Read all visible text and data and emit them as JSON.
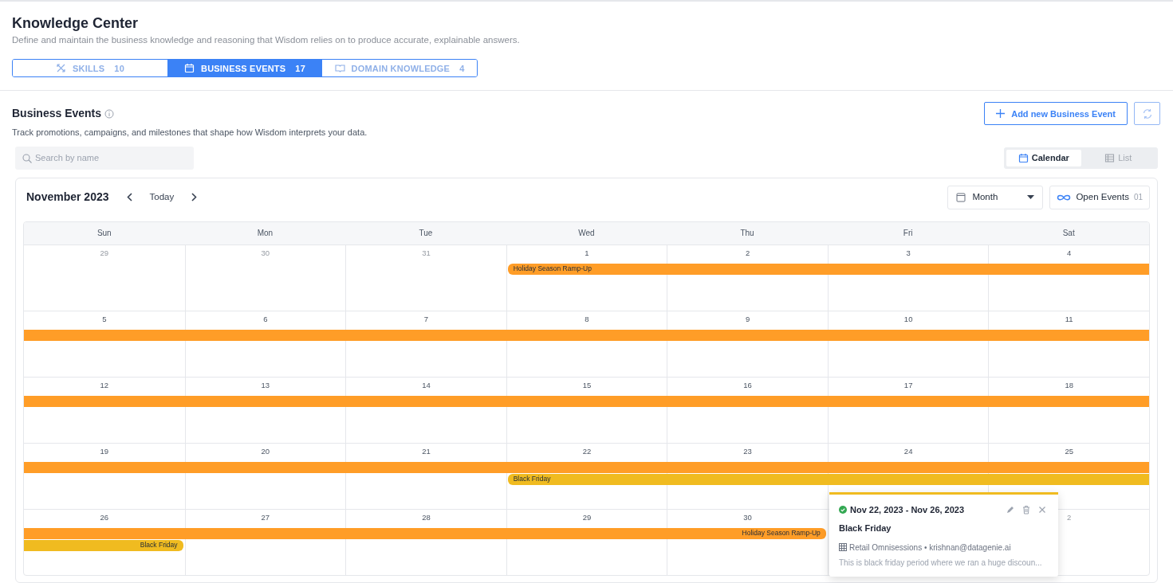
{
  "header": {
    "title": "Knowledge Center",
    "subtitle": "Define and maintain the business knowledge and reasoning that Wisdom relies on to produce accurate, explainable answers."
  },
  "tabs": [
    {
      "label": "SKILLS",
      "count": "10",
      "selected": false
    },
    {
      "label": "BUSINESS EVENTS",
      "count": "17",
      "selected": true
    },
    {
      "label": "DOMAIN KNOWLEDGE",
      "count": "4",
      "selected": false
    }
  ],
  "section": {
    "title": "Business Events",
    "description": "Track promotions, campaigns, and milestones that shape how Wisdom interprets your data.",
    "add_button": "Add new Business Event"
  },
  "search": {
    "placeholder": "Search by name"
  },
  "view_toggle": [
    {
      "label": "Calendar",
      "selected": true
    },
    {
      "label": "List",
      "selected": false
    }
  ],
  "calendar": {
    "month": "November 2023",
    "today_button": "Today",
    "view_select": "Month",
    "open_events": {
      "label": "Open Events",
      "count": "01"
    },
    "weekdays": [
      "Sun",
      "Mon",
      "Tue",
      "Wed",
      "Thu",
      "Fri",
      "Sat"
    ],
    "weeks": [
      {
        "days": [
          {
            "kind": "date",
            "number": "29",
            "outside_month": true
          },
          {
            "kind": "date",
            "number": "30",
            "outside_month": true
          },
          {
            "kind": "date",
            "number": "31",
            "outside_month": true
          },
          {
            "kind": "date",
            "number": "1",
            "outside_month": false
          },
          {
            "kind": "date",
            "number": "2",
            "outside_month": false
          },
          {
            "kind": "date",
            "number": "3",
            "outside_month": false
          },
          {
            "kind": "date",
            "number": "4",
            "outside_month": false
          }
        ],
        "lanes": [
          {
            "label": "Holiday Season Ramp-Up",
            "color": "#ff9d27",
            "segments": [
              {
                "kind": "none"
              },
              {
                "kind": "none"
              },
              {
                "kind": "none"
              },
              {
                "kind": "start"
              },
              {
                "kind": "middle"
              },
              {
                "kind": "middle"
              },
              {
                "kind": "middle"
              }
            ]
          }
        ]
      },
      {
        "days": [
          {
            "kind": "date",
            "number": "5",
            "outside_month": false
          },
          {
            "kind": "date",
            "number": "6",
            "outside_month": false
          },
          {
            "kind": "date",
            "number": "7",
            "outside_month": false
          },
          {
            "kind": "date",
            "number": "8",
            "outside_month": false
          },
          {
            "kind": "date",
            "number": "9",
            "outside_month": false
          },
          {
            "kind": "date",
            "number": "10",
            "outside_month": false
          },
          {
            "kind": "date",
            "number": "11",
            "outside_month": false
          }
        ],
        "lanes": [
          {
            "color": "#ff9d27",
            "segments": [
              {
                "kind": "middle"
              },
              {
                "kind": "middle"
              },
              {
                "kind": "middle"
              },
              {
                "kind": "middle"
              },
              {
                "kind": "middle"
              },
              {
                "kind": "middle"
              },
              {
                "kind": "middle"
              }
            ]
          }
        ]
      },
      {
        "days": [
          {
            "kind": "date",
            "number": "12",
            "outside_month": false
          },
          {
            "kind": "date",
            "number": "13",
            "outside_month": false
          },
          {
            "kind": "date",
            "number": "14",
            "outside_month": false
          },
          {
            "kind": "date",
            "number": "15",
            "outside_month": false
          },
          {
            "kind": "date",
            "number": "16",
            "outside_month": false
          },
          {
            "kind": "date",
            "number": "17",
            "outside_month": false
          },
          {
            "kind": "date",
            "number": "18",
            "outside_month": false
          }
        ],
        "lanes": [
          {
            "color": "#ff9d27",
            "segments": [
              {
                "kind": "middle"
              },
              {
                "kind": "middle"
              },
              {
                "kind": "middle"
              },
              {
                "kind": "middle"
              },
              {
                "kind": "middle"
              },
              {
                "kind": "middle"
              },
              {
                "kind": "middle"
              }
            ]
          }
        ]
      },
      {
        "days": [
          {
            "kind": "date",
            "number": "19",
            "outside_month": false
          },
          {
            "kind": "date",
            "number": "20",
            "outside_month": false
          },
          {
            "kind": "date",
            "number": "21",
            "outside_month": false
          },
          {
            "kind": "date",
            "number": "22",
            "outside_month": false
          },
          {
            "kind": "date",
            "number": "23",
            "outside_month": false
          },
          {
            "kind": "date",
            "number": "24",
            "outside_month": false
          },
          {
            "kind": "date",
            "number": "25",
            "outside_month": false
          }
        ],
        "lanes": [
          {
            "color": "#ff9d27",
            "segments": [
              {
                "kind": "middle"
              },
              {
                "kind": "middle"
              },
              {
                "kind": "middle"
              },
              {
                "kind": "middle"
              },
              {
                "kind": "middle"
              },
              {
                "kind": "middle"
              },
              {
                "kind": "middle"
              }
            ]
          },
          {
            "label": "Black Friday",
            "color": "#f0bb20",
            "segments": [
              {
                "kind": "none"
              },
              {
                "kind": "none"
              },
              {
                "kind": "none"
              },
              {
                "kind": "start"
              },
              {
                "kind": "middle"
              },
              {
                "kind": "middle"
              },
              {
                "kind": "middle"
              }
            ]
          }
        ]
      },
      {
        "days": [
          {
            "kind": "date",
            "number": "26",
            "outside_month": false
          },
          {
            "kind": "date",
            "number": "27",
            "outside_month": false
          },
          {
            "kind": "date",
            "number": "28",
            "outside_month": false
          },
          {
            "kind": "date",
            "number": "29",
            "outside_month": false
          },
          {
            "kind": "date",
            "number": "30",
            "outside_month": false
          },
          {
            "kind": "covered"
          },
          {
            "kind": "date",
            "number": "2",
            "outside_month": true
          }
        ],
        "lanes": [
          {
            "label": "Holiday Season Ramp-Up",
            "color": "#ff9d27",
            "segments": [
              {
                "kind": "middle"
              },
              {
                "kind": "middle"
              },
              {
                "kind": "middle"
              },
              {
                "kind": "middle"
              },
              {
                "kind": "end"
              },
              {
                "kind": "none"
              },
              {
                "kind": "none"
              }
            ]
          },
          {
            "label": "Black Friday",
            "color": "#f0bb20",
            "segments": [
              {
                "kind": "end"
              },
              {
                "kind": "none"
              },
              {
                "kind": "none"
              },
              {
                "kind": "none"
              },
              {
                "kind": "none"
              },
              {
                "kind": "none"
              },
              {
                "kind": "none"
              }
            ]
          }
        ]
      }
    ]
  },
  "popover": {
    "color": "#f0bb20",
    "active": true,
    "dates": "Nov 22, 2023 - Nov 26, 2023",
    "title": "Black Friday",
    "meta": "Retail Omnisessions • krishnan@datagenie.ai",
    "description": "This is black friday period where we ran a huge discoun..."
  }
}
